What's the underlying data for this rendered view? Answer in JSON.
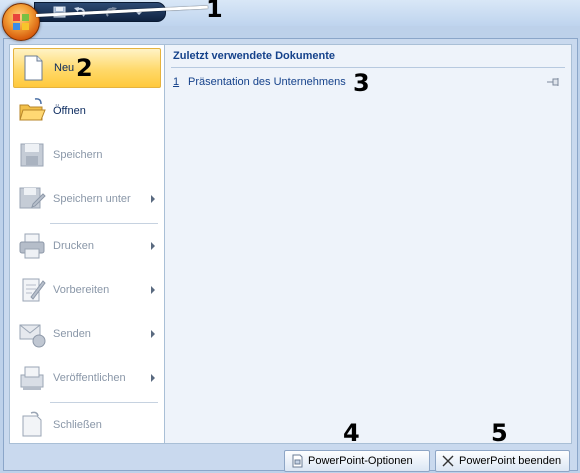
{
  "quick_access": {
    "items": [
      "save-icon",
      "undo-icon",
      "redo-icon",
      "customize-icon"
    ]
  },
  "menu": {
    "items": [
      {
        "label": "Neu",
        "icon": "new-document-icon",
        "enabled": true,
        "submenu": false,
        "active": true
      },
      {
        "label": "Öffnen",
        "icon": "open-folder-icon",
        "enabled": true,
        "submenu": false
      },
      {
        "label": "Speichern",
        "icon": "save-icon",
        "enabled": false,
        "submenu": false
      },
      {
        "label": "Speichern unter",
        "icon": "save-as-icon",
        "enabled": false,
        "submenu": true
      },
      {
        "label": "Drucken",
        "icon": "print-icon",
        "enabled": false,
        "submenu": true
      },
      {
        "label": "Vorbereiten",
        "icon": "prepare-icon",
        "enabled": false,
        "submenu": true
      },
      {
        "label": "Senden",
        "icon": "send-icon",
        "enabled": false,
        "submenu": true
      },
      {
        "label": "Veröffentlichen",
        "icon": "publish-icon",
        "enabled": false,
        "submenu": true
      },
      {
        "label": "Schließen",
        "icon": "close-document-icon",
        "enabled": false,
        "submenu": false
      }
    ]
  },
  "recent": {
    "title": "Zuletzt verwendete Dokumente",
    "items": [
      {
        "number": "1",
        "name": "Präsentation des Unternehmens",
        "icon": "pin-icon"
      }
    ]
  },
  "buttons": {
    "options": "PowerPoint-Optionen",
    "exit": "PowerPoint beenden"
  },
  "callouts": [
    "1",
    "2",
    "3",
    "4",
    "5"
  ],
  "colors": {
    "accent": "#ffc93c",
    "text": "#15428b",
    "disabled": "#8a97a8"
  }
}
